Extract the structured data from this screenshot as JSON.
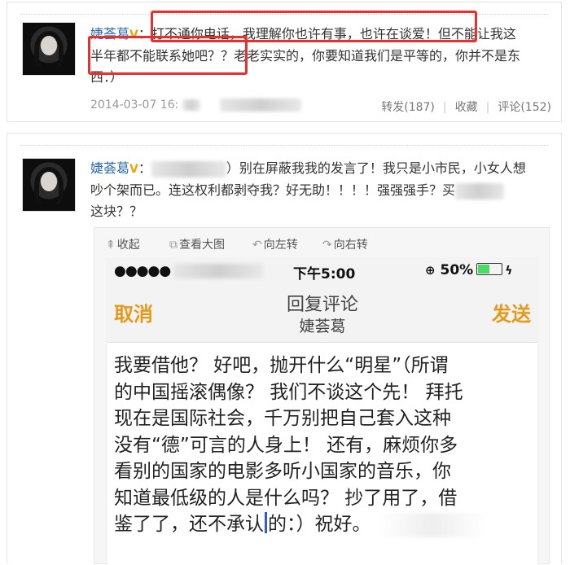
{
  "post1": {
    "username": "婕荟葛",
    "text_line1": "：打不通你电话，我理解你也许有事，也许在谈爱！但不能让我这",
    "text_line2": "半年都不能联系她吧？？老老实实的，你要知道我们是平等的，你并不是东",
    "text_line3": "西：）",
    "timestamp": "2014-03-07 16:",
    "repost": "转发(187)",
    "favorite": "收藏",
    "comment": "评论(152)"
  },
  "post2": {
    "username": "婕荟葛",
    "text_line1_a": "：",
    "text_line1_b": "）别在屏蔽我我的发言了！我只是小市民，小女人想",
    "text_line2": "吵个架而已。连这权利都剥夺我？好无助！！！！强强强手？买",
    "text_line3": "这块？？"
  },
  "image_toolbar": {
    "collapse": "收起",
    "view_large": "查看大图",
    "rotate_left": "向左转",
    "rotate_right": "向右转"
  },
  "phone": {
    "time": "下午5:00",
    "battery": "50%",
    "cancel": "取消",
    "send": "发送",
    "title": "回复评论",
    "subtitle": "婕荟葛",
    "reply_lines": [
      "我要借他？ 好吧，抛开什么“明星”（所谓",
      "的中国摇滚偶像？ 我们不谈这个先！ 拜托",
      "现在是国际社会，千万别把自己套入这种",
      "没有“德”可言的人身上！ 还有，麻烦你多",
      "看别的国家的电影多听小国家的音乐，你",
      "知道最低级的人是什么吗？ 抄了用了，借",
      "鉴了了，还不承认",
      "的：）祝好。"
    ]
  },
  "colors": {
    "link_blue": "#2b6bb3",
    "highlight_red": "#e8302e",
    "nav_orange": "#e39a1a",
    "battery_green": "#4cd964"
  },
  "icons": [
    "verified-icon",
    "collapse-icon",
    "view-large-icon",
    "rotate-left-icon",
    "rotate-right-icon",
    "signal-dots-icon",
    "lock-rotation-icon",
    "battery-icon",
    "charging-icon"
  ]
}
